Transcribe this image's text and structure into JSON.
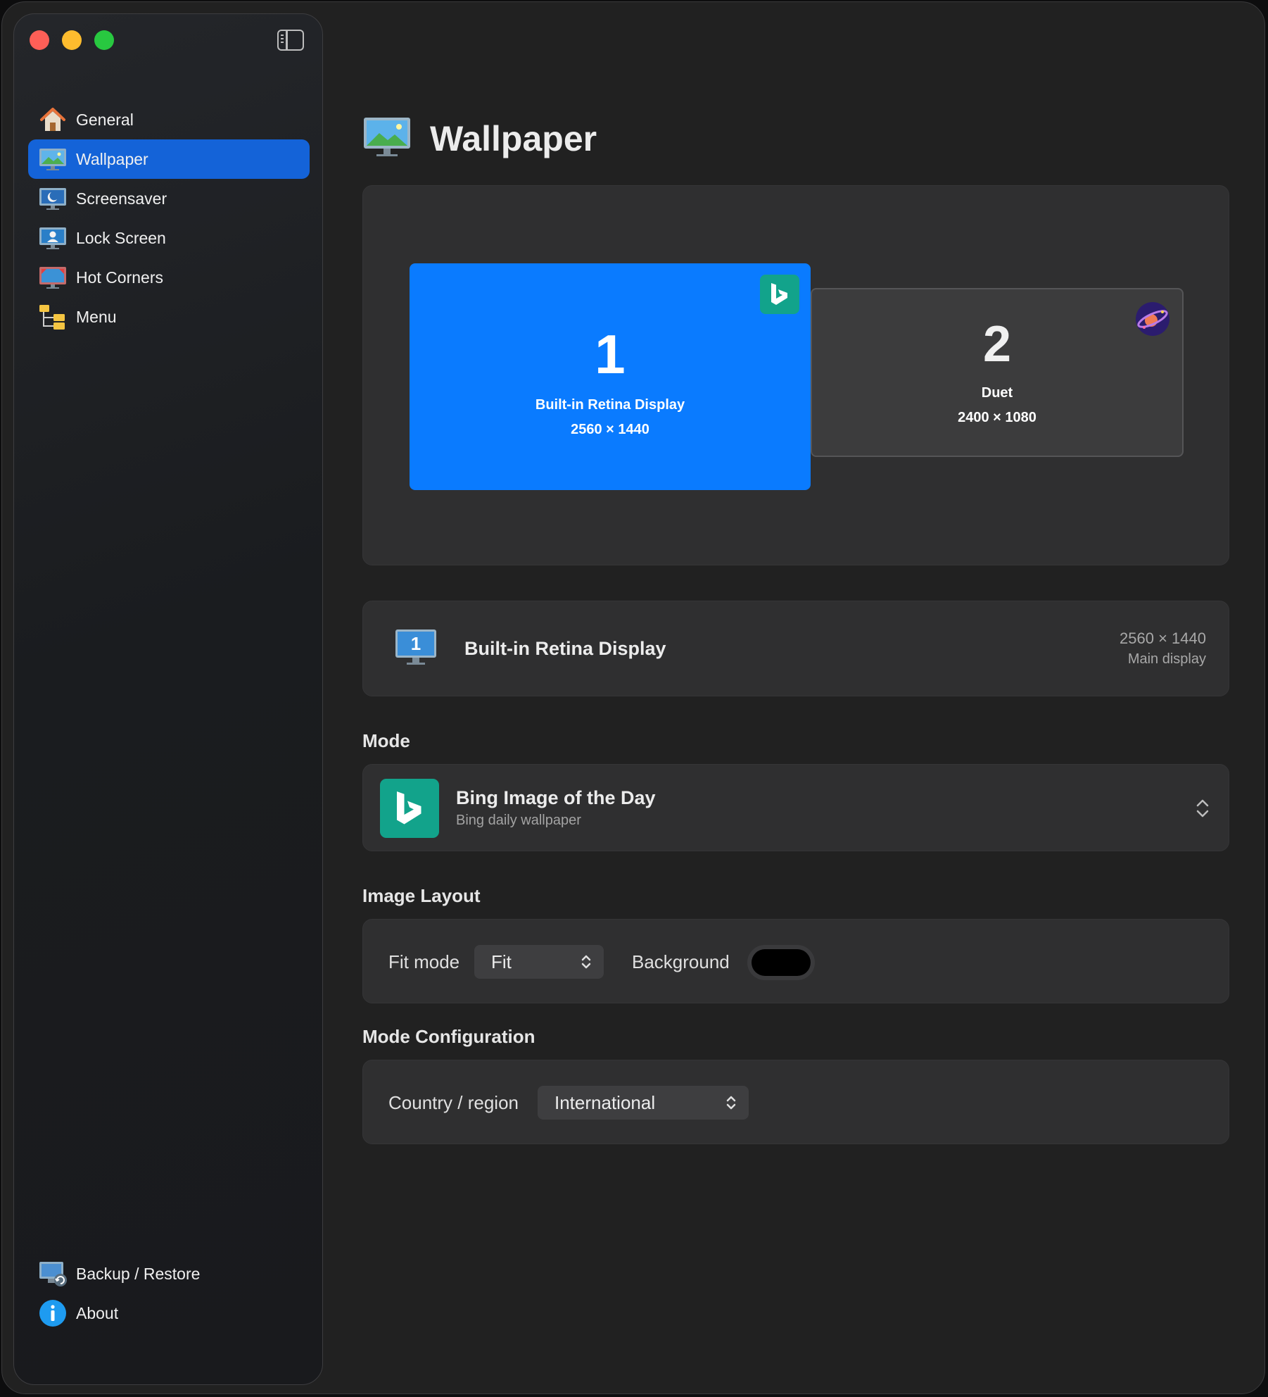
{
  "sidebar": {
    "items": [
      {
        "label": "General",
        "icon": "house-icon"
      },
      {
        "label": "Wallpaper",
        "icon": "monitor-landscape-icon",
        "active": true
      },
      {
        "label": "Screensaver",
        "icon": "monitor-moon-icon"
      },
      {
        "label": "Lock Screen",
        "icon": "monitor-user-icon"
      },
      {
        "label": "Hot Corners",
        "icon": "monitor-red-icon"
      },
      {
        "label": "Menu",
        "icon": "folder-tree-icon"
      }
    ],
    "bottom_items": [
      {
        "label": "Backup / Restore",
        "icon": "backup-restore-icon"
      },
      {
        "label": "About",
        "icon": "info-icon"
      }
    ]
  },
  "page": {
    "title": "Wallpaper"
  },
  "displays": [
    {
      "number": "1",
      "name": "Built-in Retina Display",
      "resolution": "2560 × 1440",
      "selected": true,
      "badge": "bing-icon"
    },
    {
      "number": "2",
      "name": "Duet",
      "resolution": "2400 × 1080",
      "selected": false,
      "badge": "planet-icon"
    }
  ],
  "selected_display": {
    "number": "1",
    "name": "Built-in Retina Display",
    "resolution": "2560 × 1440",
    "subtitle": "Main display"
  },
  "mode": {
    "section": "Mode",
    "title": "Bing Image of the Day",
    "subtitle": "Bing daily wallpaper"
  },
  "image_layout": {
    "section": "Image Layout",
    "fit_label": "Fit mode",
    "fit_value": "Fit",
    "background_label": "Background",
    "background_color": "#000000"
  },
  "mode_config": {
    "section": "Mode Configuration",
    "country_label": "Country / region",
    "country_value": "International"
  },
  "colors": {
    "accent": "#1463d8",
    "display_selected": "#0a7bff",
    "bing": "#12a38b"
  }
}
